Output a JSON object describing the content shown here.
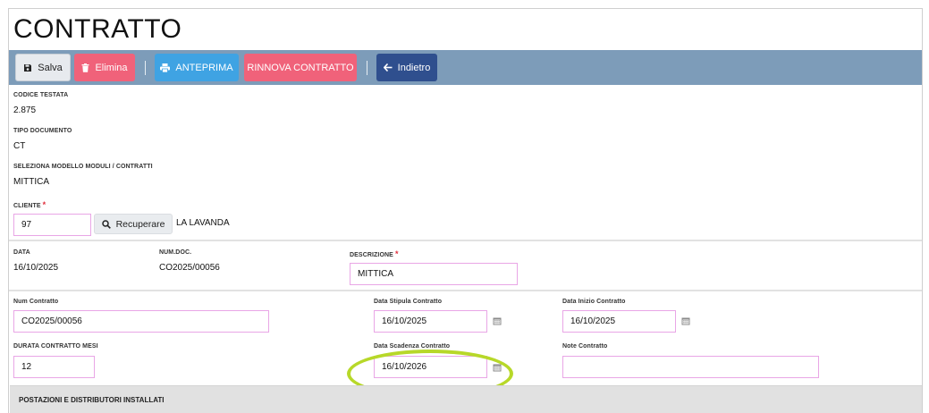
{
  "title": "CONTRATTO",
  "toolbar": {
    "salva": "Salva",
    "elimina": "Elimina",
    "anteprima": "ANTEPRIMA",
    "rinnova": "RINNOVA CONTRATTO",
    "indietro": "Indietro"
  },
  "header": {
    "codice_label": "CODICE TESTATA",
    "codice_value": "2.875",
    "tipo_label": "TIPO DOCUMENTO",
    "tipo_value": "CT",
    "modello_label": "SELEZIONA MODELLO MODULI / CONTRATTI",
    "modello_value": "MITTICA",
    "cliente_label": "CLIENTE",
    "cliente_required": "*",
    "cliente_value": "97",
    "recupera_label": "Recuperare",
    "cliente_name": "LA LAVANDA"
  },
  "doc": {
    "data_label": "DATA",
    "data_value": "16/10/2025",
    "numdoc_label": "NUM.DOC.",
    "numdoc_value": "CO2025/00056",
    "descr_label": "DESCRIZIONE",
    "descr_required": "*",
    "descr_value": "MITTICA"
  },
  "contract": {
    "num_label": "Num Contratto",
    "num_value": "CO2025/00056",
    "stipula_label": "Data Stipula Contratto",
    "stipula_value": "16/10/2025",
    "inizio_label": "Data Inizio Contratto",
    "inizio_value": "16/10/2025",
    "durata_label": "DURATA CONTRATTO MESI",
    "durata_value": "12",
    "scadenza_label": "Data Scadenza Contratto",
    "scadenza_value": "16/10/2026",
    "note_label": "Note Contratto",
    "note_value": ""
  },
  "section": {
    "title": "POSTAZIONI E DISTRIBUTORI INSTALLATI"
  },
  "colors": {
    "toolbar": "#7d9cb9",
    "danger": "#f0627a",
    "info": "#3fa3e3",
    "back": "#2f4f8e",
    "input_border": "#e9a6e6",
    "highlight": "#b7d829"
  }
}
